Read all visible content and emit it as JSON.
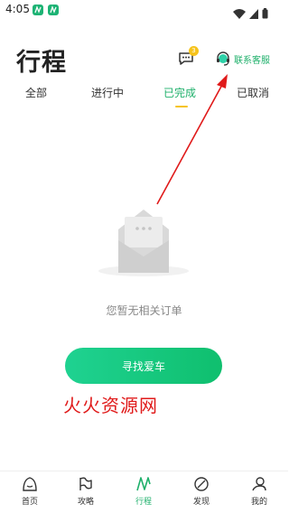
{
  "status": {
    "time": "4:05"
  },
  "header": {
    "title": "行程",
    "message_badge": "3",
    "customer_service_label": "联系客服"
  },
  "tabs": [
    {
      "label": "全部",
      "active": false
    },
    {
      "label": "进行中",
      "active": false
    },
    {
      "label": "已完成",
      "active": true
    },
    {
      "label": "已取消",
      "active": false
    }
  ],
  "empty_state": {
    "message": "您暂无相关订单",
    "button_label": "寻找爱车"
  },
  "watermark": "火火资源网",
  "bottom_nav": [
    {
      "label": "首页",
      "icon": "home-icon",
      "active": false
    },
    {
      "label": "攻略",
      "icon": "flag-icon",
      "active": false
    },
    {
      "label": "行程",
      "icon": "trip-icon",
      "active": true
    },
    {
      "label": "发现",
      "icon": "compass-icon",
      "active": false
    },
    {
      "label": "我的",
      "icon": "profile-icon",
      "active": false
    }
  ],
  "colors": {
    "accent": "#1fb06b",
    "indicator": "#f6c31c",
    "annotation": "#e01a1a"
  }
}
